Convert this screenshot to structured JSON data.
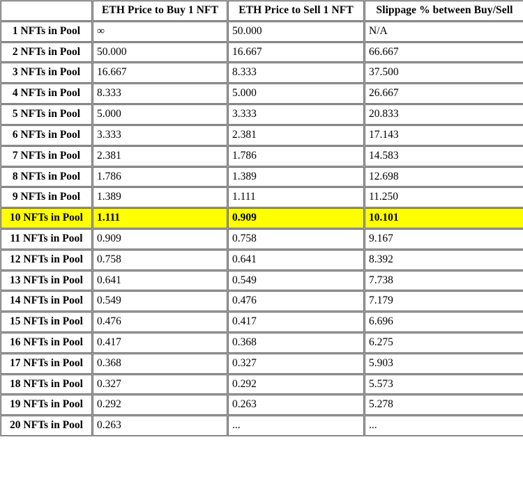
{
  "table": {
    "columns": [
      {
        "key": "label",
        "header": ""
      },
      {
        "key": "buy",
        "header": "ETH Price to Buy 1 NFT"
      },
      {
        "key": "sell",
        "header": "ETH Price to Sell 1 NFT"
      },
      {
        "key": "slippage",
        "header": "Slippage % between Buy/Sell"
      }
    ],
    "highlight_color": "#FFFF00",
    "highlight_row_index": 9,
    "rows": [
      {
        "label": "1 NFTs in Pool",
        "buy": "∞",
        "sell": "50.000",
        "slippage": "N/A",
        "highlighted": false
      },
      {
        "label": "2 NFTs in Pool",
        "buy": "50.000",
        "sell": "16.667",
        "slippage": "66.667",
        "highlighted": false
      },
      {
        "label": "3 NFTs in Pool",
        "buy": "16.667",
        "sell": "8.333",
        "slippage": "37.500",
        "highlighted": false
      },
      {
        "label": "4 NFTs in Pool",
        "buy": "8.333",
        "sell": "5.000",
        "slippage": "26.667",
        "highlighted": false
      },
      {
        "label": "5 NFTs in Pool",
        "buy": "5.000",
        "sell": "3.333",
        "slippage": "20.833",
        "highlighted": false
      },
      {
        "label": "6 NFTs in Pool",
        "buy": "3.333",
        "sell": "2.381",
        "slippage": "17.143",
        "highlighted": false
      },
      {
        "label": "7 NFTs in Pool",
        "buy": "2.381",
        "sell": "1.786",
        "slippage": "14.583",
        "highlighted": false
      },
      {
        "label": "8 NFTs in Pool",
        "buy": "1.786",
        "sell": "1.389",
        "slippage": "12.698",
        "highlighted": false
      },
      {
        "label": "9 NFTs in Pool",
        "buy": "1.389",
        "sell": "1.111",
        "slippage": "11.250",
        "highlighted": false
      },
      {
        "label": "10 NFTs in Pool",
        "buy": "1.111",
        "sell": "0.909",
        "slippage": "10.101",
        "highlighted": true
      },
      {
        "label": "11 NFTs in Pool",
        "buy": "0.909",
        "sell": "0.758",
        "slippage": "9.167",
        "highlighted": false
      },
      {
        "label": "12 NFTs in Pool",
        "buy": "0.758",
        "sell": "0.641",
        "slippage": "8.392",
        "highlighted": false
      },
      {
        "label": "13 NFTs in Pool",
        "buy": "0.641",
        "sell": "0.549",
        "slippage": "7.738",
        "highlighted": false
      },
      {
        "label": "14 NFTs in Pool",
        "buy": "0.549",
        "sell": "0.476",
        "slippage": "7.179",
        "highlighted": false
      },
      {
        "label": "15 NFTs in Pool",
        "buy": "0.476",
        "sell": "0.417",
        "slippage": "6.696",
        "highlighted": false
      },
      {
        "label": "16 NFTs in Pool",
        "buy": "0.417",
        "sell": "0.368",
        "slippage": "6.275",
        "highlighted": false
      },
      {
        "label": "17 NFTs in Pool",
        "buy": "0.368",
        "sell": "0.327",
        "slippage": "5.903",
        "highlighted": false
      },
      {
        "label": "18 NFTs in Pool",
        "buy": "0.327",
        "sell": "0.292",
        "slippage": "5.573",
        "highlighted": false
      },
      {
        "label": "19 NFTs in Pool",
        "buy": "0.292",
        "sell": "0.263",
        "slippage": "5.278",
        "highlighted": false
      },
      {
        "label": "20 NFTs in Pool",
        "buy": "0.263",
        "sell": "...",
        "slippage": "...",
        "highlighted": false
      }
    ]
  }
}
